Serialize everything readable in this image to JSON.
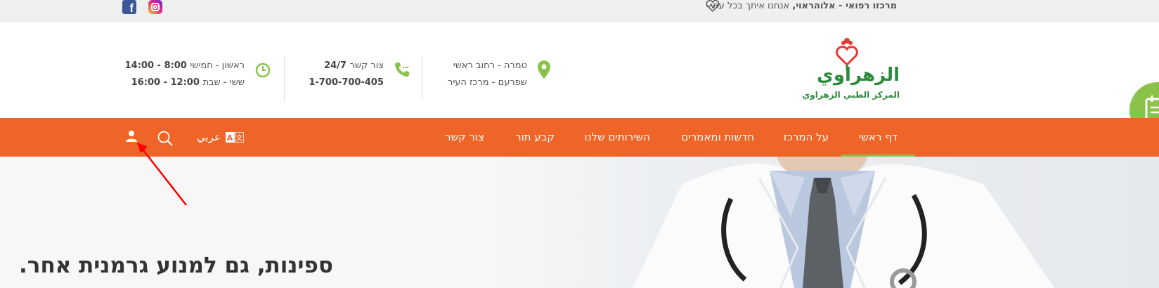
{
  "topbar": {
    "tagline_bold": "מרכזו רפואי - אלוהראוי,",
    "tagline_text": "אנחנו איתך בכל עת",
    "facebook_letter": "f"
  },
  "logo": {
    "arabic_name": "الزهراوي",
    "subtitle": "المركز الطبي الزهراوي"
  },
  "contact": {
    "location": {
      "line1_label": "טמרה",
      "line1_value": " - רחוב ראשי",
      "line2_label": "שפרעם",
      "line2_value": " - מרכז העיר"
    },
    "phone": {
      "line1_label": "צור קשר",
      "line1_value": " 24/7",
      "number": "1-700-700-405"
    },
    "hours": {
      "line1_label": "ראשון - חמישי",
      "line1_value": " 8:00 - 14:00",
      "line2_label": "ששי - שבת",
      "line2_value": " 12:00 - 16:00"
    }
  },
  "nav": {
    "items": [
      {
        "label": "דף ראשי",
        "active": true
      },
      {
        "label": "על המרכז"
      },
      {
        "label": "חדשות ומאמרים"
      },
      {
        "label": "השירותים שלנו"
      },
      {
        "label": "קבע תור"
      },
      {
        "label": "צור קשר"
      }
    ],
    "language_label": "عربي"
  },
  "hero": {
    "title": "ספינות, גם למנוע גרמנית אחר."
  },
  "colors": {
    "accent_orange": "#ef6527",
    "accent_green": "#8bc34a",
    "logo_green": "#2e8b3e",
    "logo_red": "#e53935"
  },
  "icons": [
    "heart-pulse-icon",
    "facebook-icon",
    "instagram-icon",
    "map-pin-icon",
    "phone-icon",
    "clock-icon",
    "calendar-icon",
    "language-icon",
    "search-icon",
    "user-icon"
  ]
}
